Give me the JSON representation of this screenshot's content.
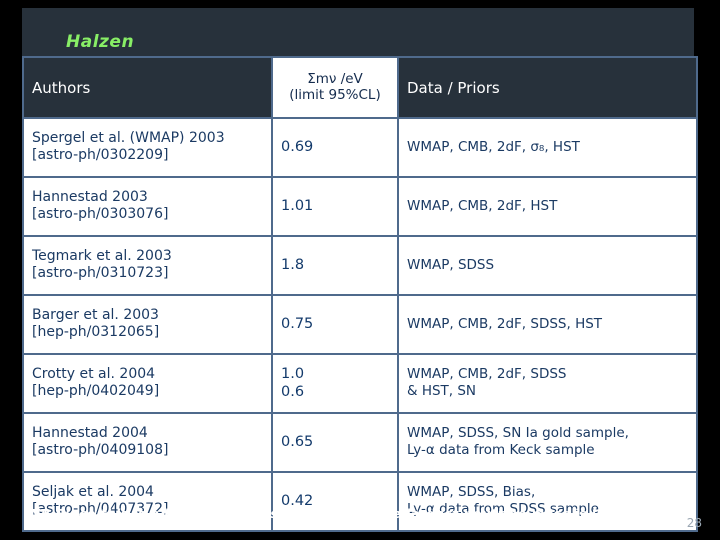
{
  "slide": {
    "title": "Halzen",
    "footer_note": "NB Since this is a large mass this implies that the largest neutrino mass is limit/3",
    "page_number": "28"
  },
  "table": {
    "headers": {
      "col1": "Authors",
      "col2_line1": "Σmν /eV",
      "col2_line2": "(limit 95%CL)",
      "col3": "Data / Priors"
    },
    "rows": [
      {
        "author": "Spergel et al. (WMAP) 2003",
        "ref": "[astro-ph/0302209]",
        "limit_line1": "0.69",
        "limit_line2": "",
        "data_line1": "WMAP, CMB, 2dF, σ₈, HST",
        "data_line2": ""
      },
      {
        "author": "Hannestad 2003",
        "ref": "[astro-ph/0303076]",
        "limit_line1": "1.01",
        "limit_line2": "",
        "data_line1": "WMAP, CMB, 2dF, HST",
        "data_line2": ""
      },
      {
        "author": "Tegmark et al. 2003",
        "ref": "[astro-ph/0310723]",
        "limit_line1": "1.8",
        "limit_line2": "",
        "data_line1": "WMAP, SDSS",
        "data_line2": ""
      },
      {
        "author": "Barger et al. 2003",
        "ref": "[hep-ph/0312065]",
        "limit_line1": "0.75",
        "limit_line2": "",
        "data_line1": "WMAP, CMB, 2dF, SDSS, HST",
        "data_line2": ""
      },
      {
        "author": "Crotty et al. 2004",
        "ref": "[hep-ph/0402049]",
        "limit_line1": "1.0",
        "limit_line2": "0.6",
        "data_line1": "WMAP, CMB, 2dF, SDSS",
        "data_line2": "& HST, SN"
      },
      {
        "author": "Hannestad 2004",
        "ref": "[astro-ph/0409108]",
        "limit_line1": "0.65",
        "limit_line2": "",
        "data_line1": "WMAP, SDSS, SN Ia gold sample,",
        "data_line2": "Ly-α data from Keck sample"
      },
      {
        "author": "Seljak et al. 2004",
        "ref": "[astro-ph/0407372]",
        "limit_line1": "0.42",
        "limit_line2": "",
        "data_line1": "WMAP, SDSS, Bias,",
        "data_line2": "Ly-α data from SDSS sample"
      }
    ]
  }
}
